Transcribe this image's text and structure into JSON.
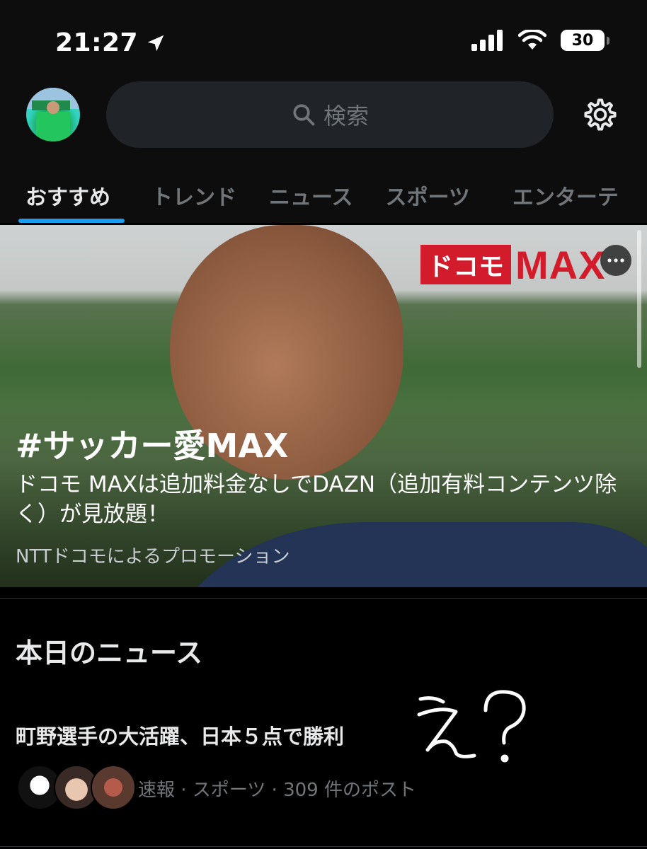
{
  "status_bar": {
    "time": "21:27",
    "battery": "30"
  },
  "header": {
    "search_placeholder": "検索"
  },
  "tabs": [
    {
      "label": "おすすめ",
      "active": true
    },
    {
      "label": "トレンド",
      "active": false
    },
    {
      "label": "ニュース",
      "active": false
    },
    {
      "label": "スポーツ",
      "active": false
    },
    {
      "label": "エンターテ",
      "active": false
    }
  ],
  "promo": {
    "logo_left": "ドコモ",
    "logo_right": "MAX",
    "title": "#サッカー愛MAX",
    "description": "ドコモ MAXは追加料金なしでDAZN（追加有料コンテンツ除く）が見放題！",
    "advertiser": "NTTドコモによるプロモーション"
  },
  "news_section": {
    "heading": "本日のニュース",
    "items": [
      {
        "title": "町野選手の大活躍、日本５点で勝利",
        "meta": "速報 · スポーツ · 309 件のポスト"
      }
    ]
  },
  "annotation": {
    "handwritten_text": "え？"
  },
  "colors": {
    "accent": "#1d9bf0",
    "background": "#000000",
    "header_bg": "#0d0d0e",
    "muted_text": "#71767b",
    "docomo_red": "#d21c2c"
  }
}
